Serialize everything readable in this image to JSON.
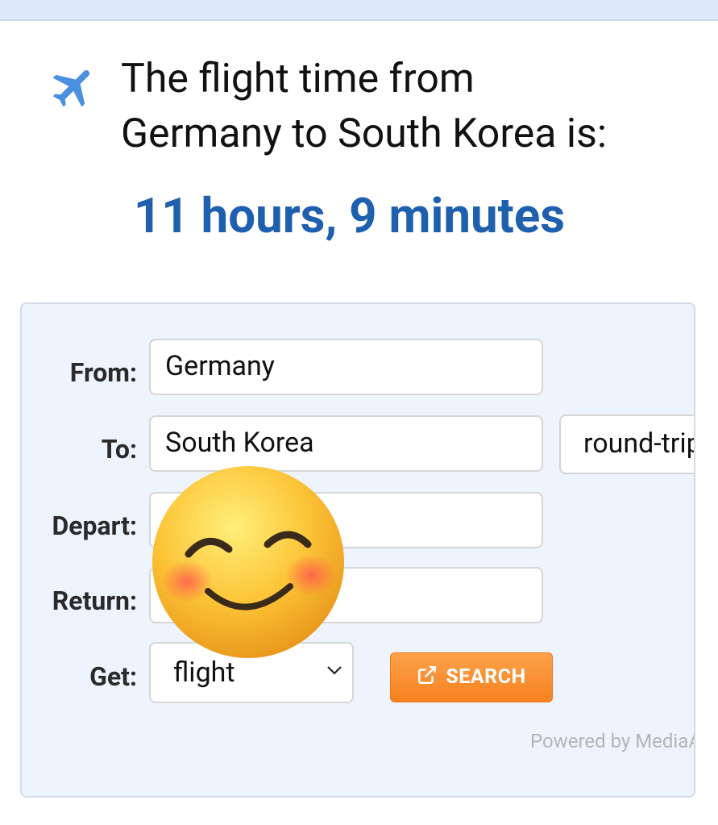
{
  "header": {
    "icon": "plane-icon",
    "line1": "The flight time from",
    "line2": "Germany to South Korea is:",
    "result": "11 hours, 9 minutes",
    "result_color": "#1e60ad"
  },
  "form": {
    "from_label": "From:",
    "from_value": "Germany",
    "to_label": "To:",
    "to_value": "South Korea",
    "trip_type": "round-trip",
    "depart_label": "Depart:",
    "depart_value": "",
    "return_label": "Return:",
    "return_value": "",
    "get_label": "Get:",
    "get_selected": "flight",
    "search_label": "SEARCH",
    "search_icon": "external-link-icon",
    "search_color": "#f7811f",
    "powered_by": "Powered by MediaA"
  },
  "overlay": {
    "emoji": "smiling-face-emoji"
  }
}
